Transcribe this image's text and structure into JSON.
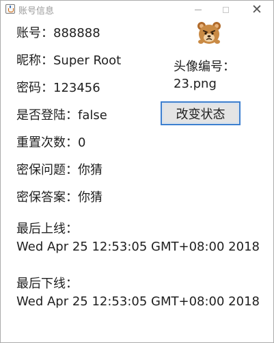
{
  "window": {
    "title": "账号信息",
    "close_glyph": "✕"
  },
  "icons": {
    "app_icon": "java-cup-icon",
    "avatar": "bear-avatar-icon"
  },
  "fields": {
    "account": {
      "label": "账号：",
      "value": "888888"
    },
    "nickname": {
      "label": "昵称：",
      "value": "Super Root"
    },
    "password": {
      "label": "密码：",
      "value": "123456"
    },
    "logged_in": {
      "label": "是否登陆：",
      "value": "false"
    },
    "reset_count": {
      "label": "重置次数：",
      "value": "0"
    },
    "security_question": {
      "label": "密保问题：",
      "value": "你猜"
    },
    "security_answer": {
      "label": "密保答案：",
      "value": "你猜"
    }
  },
  "avatar": {
    "label": "头像编号：",
    "file": "23.png"
  },
  "state_button": {
    "label": "改变状态"
  },
  "last_login": {
    "label": "最后上线：",
    "value": "Wed Apr 25 12:53:05 GMT+08:00 2018"
  },
  "last_logout": {
    "label": "最后下线：",
    "value": "Wed Apr 25 12:53:05 GMT+08:00 2018"
  },
  "colors": {
    "button_border": "#3c7fd0",
    "button_bg": "#e4e4e4",
    "text": "#202020",
    "title_text": "#9a9a9a"
  }
}
